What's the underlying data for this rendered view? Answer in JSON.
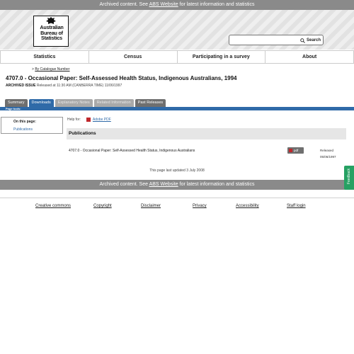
{
  "archive_bar": {
    "prefix": "Archived content. See ",
    "link": "ABS Website",
    "suffix": " for latest information and statistics"
  },
  "logo": {
    "lines": [
      "Australian",
      "Bureau of",
      "Statistics"
    ]
  },
  "search": {
    "placeholder": "",
    "button_label": "Search"
  },
  "nav": {
    "items": [
      "Statistics",
      "Census",
      "Participating in a survey",
      "About"
    ]
  },
  "breadcrumb": {
    "prefix": "> ",
    "link": "By Catalogue Number"
  },
  "page": {
    "title": "4707.0 - Occasional Paper: Self-Assessed Health Status, Indigenous Australians, 1994",
    "archived_label": "ARCHIVED ISSUE",
    "released_text": " Released at 11:30 AM (CANBERRA TIME) 11/06/1997"
  },
  "tabs": [
    {
      "label": "Summary",
      "state": "normal"
    },
    {
      "label": "Downloads",
      "state": "active"
    },
    {
      "label": "Explanatory Notes",
      "state": "disabled"
    },
    {
      "label": "Related Information",
      "state": "disabled"
    },
    {
      "label": "Past Releases",
      "state": "normal"
    }
  ],
  "page_tools": {
    "label": "Page tools:"
  },
  "on_this_page": {
    "title": "On this page:",
    "link": "Publications"
  },
  "help_for": {
    "label": "Help for:",
    "link": "Adobe PDF"
  },
  "publications": {
    "header": "Publications",
    "items": [
      {
        "title": "4707.0 - Occasional Paper: Self-Assessed Health Status, Indigenous Australians",
        "button_label": "pdf",
        "released_label": "Released",
        "released_date": "05/06/1997"
      }
    ]
  },
  "updated": "This page last updated 3 July 2008",
  "footer": {
    "links": [
      "Creative commons",
      "Copyright",
      "Disclaimer",
      "Privacy",
      "Accessibility",
      "Staff login"
    ]
  },
  "feedback": {
    "label": "Feedback"
  },
  "colors": {
    "accent": "#2f6aa8",
    "archive_bar": "#8a8a8a",
    "feedback": "#26a163",
    "pdf_red": "#c0282c"
  }
}
